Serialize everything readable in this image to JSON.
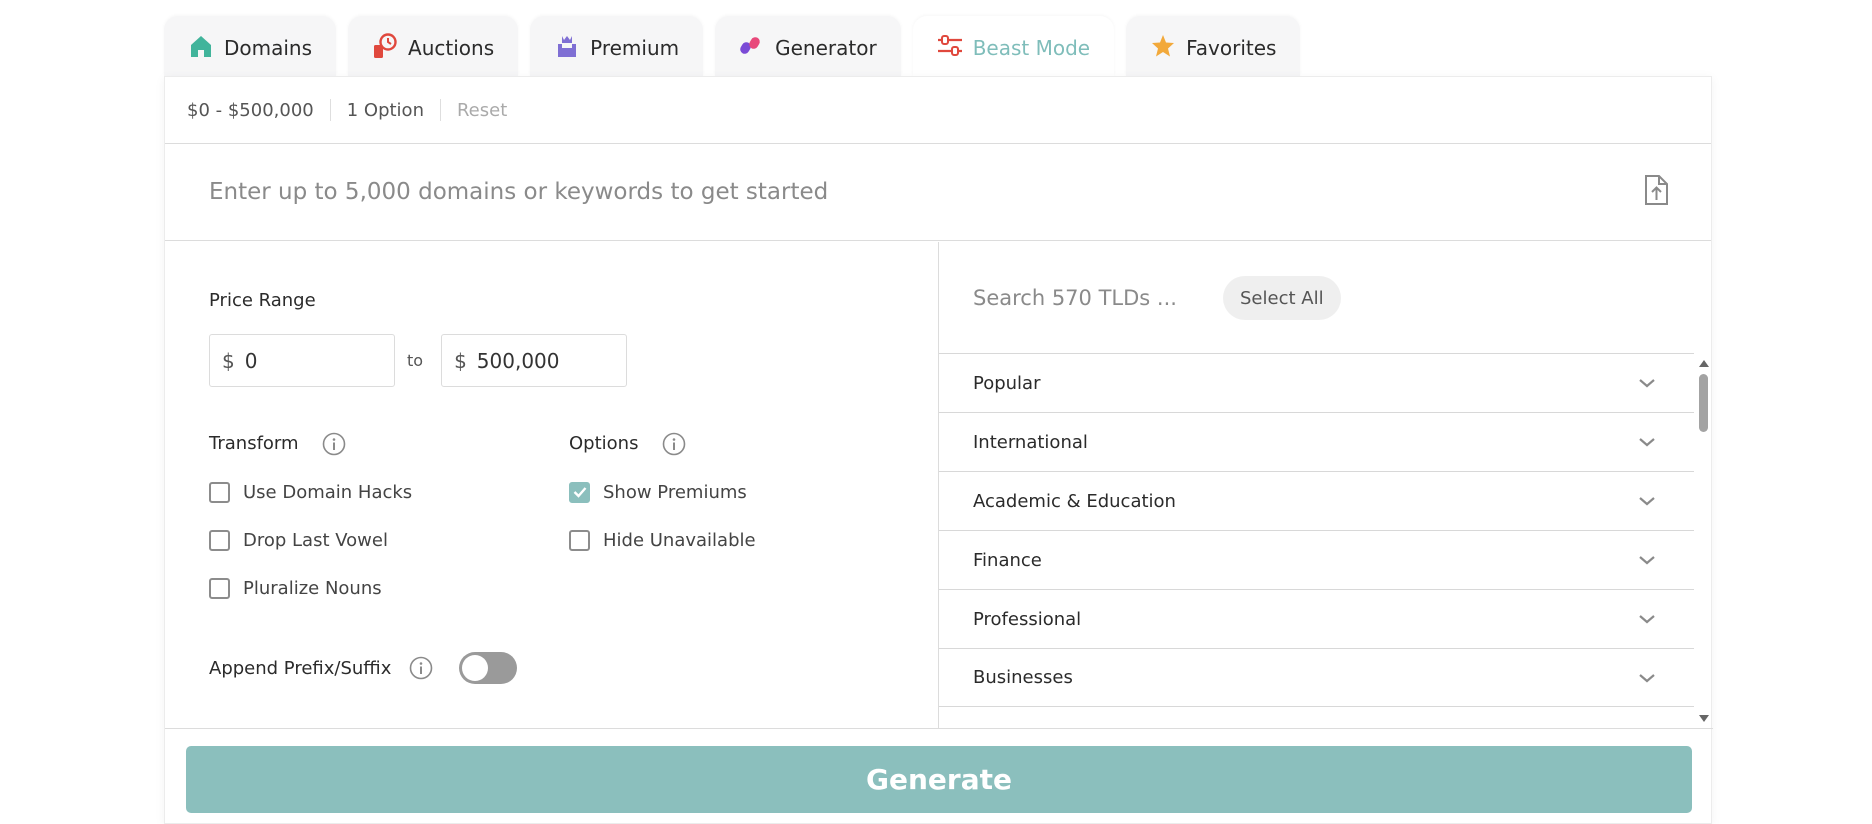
{
  "tabs": [
    {
      "label": "Domains",
      "icon": "house-icon"
    },
    {
      "label": "Auctions",
      "icon": "auction-clock-icon"
    },
    {
      "label": "Premium",
      "icon": "castle-crown-icon"
    },
    {
      "label": "Generator",
      "icon": "shapes-icon"
    },
    {
      "label": "Beast Mode",
      "icon": "sliders-icon",
      "active": true
    },
    {
      "label": "Favorites",
      "icon": "star-icon"
    }
  ],
  "summary": {
    "price": "$0 - $500,000",
    "options": "1 Option",
    "reset": "Reset"
  },
  "keyword": {
    "placeholder": "Enter up to 5,000 domains or keywords to get started",
    "upload_icon": "file-upload-icon"
  },
  "price_range": {
    "label": "Price Range",
    "currency": "$",
    "min": "0",
    "to": "to",
    "max": "500,000"
  },
  "transform": {
    "label": "Transform",
    "items": [
      {
        "label": "Use Domain Hacks",
        "checked": false
      },
      {
        "label": "Drop Last Vowel",
        "checked": false
      },
      {
        "label": "Pluralize Nouns",
        "checked": false
      }
    ]
  },
  "options": {
    "label": "Options",
    "items": [
      {
        "label": "Show Premiums",
        "checked": true
      },
      {
        "label": "Hide Unavailable",
        "checked": false
      }
    ]
  },
  "append": {
    "label": "Append Prefix/Suffix",
    "enabled": false
  },
  "tlds": {
    "search_placeholder": "Search 570 TLDs ...",
    "select_all": "Select All",
    "categories": [
      "Popular",
      "International",
      "Academic & Education",
      "Finance",
      "Professional",
      "Businesses"
    ]
  },
  "generate": {
    "label": "Generate"
  },
  "colors": {
    "accent": "#8bbfbd",
    "active_tab_text": "#7fbdba"
  }
}
